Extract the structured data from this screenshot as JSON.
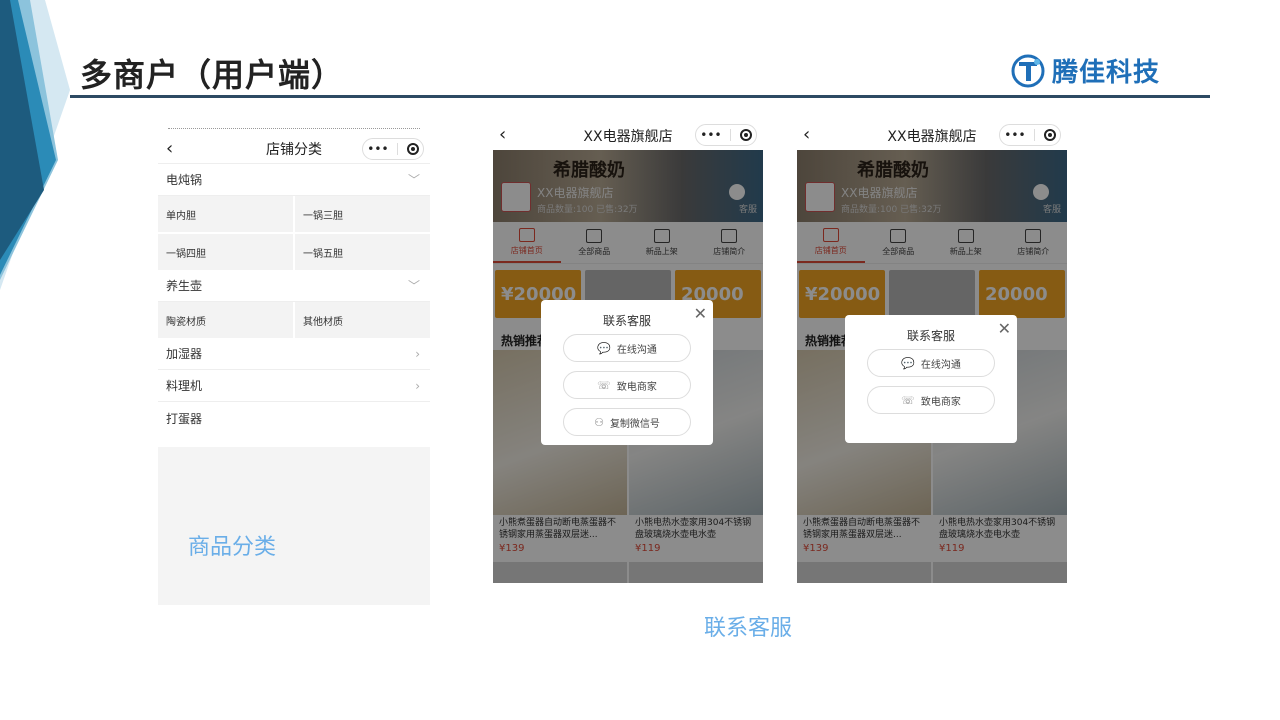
{
  "slide": {
    "title": "多商户（用户端）",
    "logo_text": "腾佳科技",
    "caption_category": "商品分类",
    "caption_contact": "联系客服"
  },
  "phone_category": {
    "nav_title": "店铺分类",
    "capsule_more": "•••",
    "back_glyph": "‹",
    "groups": [
      {
        "label": "电炖锅",
        "arrow": "﹀",
        "subs": [
          "单内胆",
          "一锅三胆",
          "一锅四胆",
          "一锅五胆"
        ]
      },
      {
        "label": "养生壶",
        "arrow": "﹀",
        "subs": [
          "陶瓷材质",
          "其他材质"
        ]
      }
    ],
    "rows": [
      {
        "label": "加湿器",
        "arrow": "›"
      },
      {
        "label": "料理机",
        "arrow": "›"
      },
      {
        "label": "打蛋器",
        "arrow": ""
      }
    ]
  },
  "phone_store": {
    "nav_title": "XX电器旗舰店",
    "capsule_more": "•••",
    "back_glyph": "‹",
    "banner_title": "希腊酸奶",
    "shop_name": "XX电器旗舰店",
    "shop_stats": "商品数量:100   已售:32万",
    "kefu": "客服",
    "tabs": [
      "店铺首页",
      "全部商品",
      "新品上架",
      "店铺简介"
    ],
    "coupon_a": "¥20000",
    "coupon_b": "20000",
    "hot_label": "热销推荐",
    "products": [
      {
        "name": "小熊煮蛋器自动断电蒸蛋器不锈钢家用蒸蛋器双层迷...",
        "price": "¥139"
      },
      {
        "name": "小熊电热水壶家用304不锈钢盘玻璃烧水壶电水壶",
        "price": "¥119"
      }
    ],
    "modal": {
      "title": "联系客服",
      "close": "✕",
      "btn_online": "在线沟通",
      "btn_call": "致电商家",
      "btn_wechat": "复制微信号"
    }
  },
  "colors": {
    "title_rule": "#2d4a63",
    "caption": "#6aaee8",
    "accent_red": "#e04b3a",
    "coupon": "#f5a623",
    "logo": "#1f6fb8"
  }
}
